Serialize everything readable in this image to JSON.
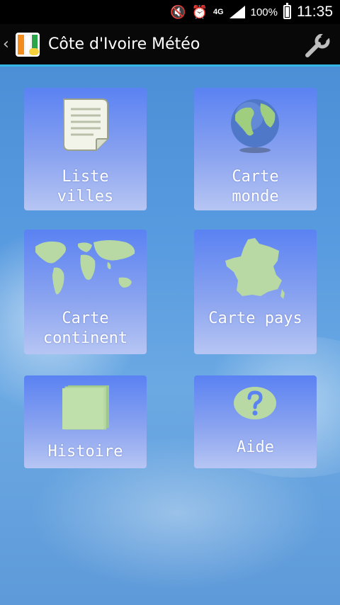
{
  "status_bar": {
    "network": "4G",
    "battery": "100%",
    "time": "11:35"
  },
  "app_bar": {
    "title": "Côte d'Ivoire Météo"
  },
  "tiles": [
    {
      "line1": "Liste",
      "line2": "villes"
    },
    {
      "line1": "Carte",
      "line2": "monde"
    },
    {
      "line1": "Carte",
      "line2": "continent"
    },
    {
      "line1": "Carte pays"
    },
    {
      "line1": "Histoire"
    },
    {
      "line1": "Aide"
    }
  ],
  "icons": {
    "list": "list-document-icon",
    "globe": "globe-icon",
    "world_map": "world-map-icon",
    "country_map": "france-map-icon",
    "book": "book-icon",
    "help": "help-icon",
    "settings": "wrench-icon"
  },
  "colors": {
    "tile_top": "#5a82f2",
    "tile_bottom": "#b6c5f3",
    "icon_green": "#b8d9a3",
    "action_bar": "#080808",
    "accent_line": "#33b5e5"
  }
}
